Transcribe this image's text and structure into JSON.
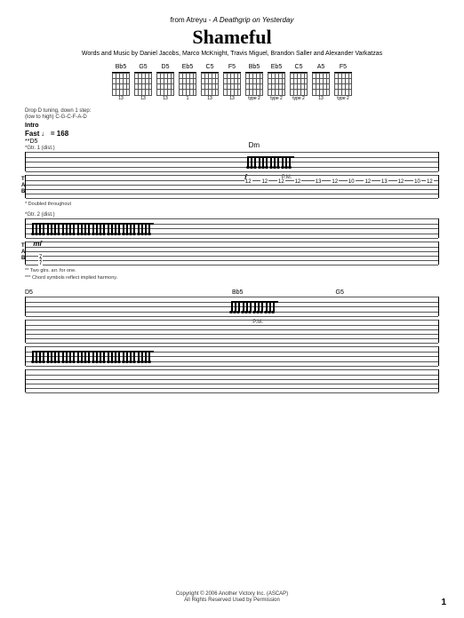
{
  "header": {
    "source_prefix": "from Atreyu - ",
    "album": "A Deathgrip on Yesterday",
    "title": "Shameful",
    "composers": "Words and Music by Daniel Jacobs, Marco McKnight, Travis Miguel, Brandon Saller and Alexander Varkatzas"
  },
  "chord_diagrams": [
    {
      "label": "Bb5",
      "sub": "13"
    },
    {
      "label": "G5",
      "sub": "13"
    },
    {
      "label": "D5",
      "sub": "13"
    },
    {
      "label": "Eb5",
      "sub": "1"
    },
    {
      "label": "C5",
      "sub": "13"
    },
    {
      "label": "F5",
      "sub": "13"
    },
    {
      "label": "Bb5",
      "sub": "type 2"
    },
    {
      "label": "Eb5",
      "sub": "type 2"
    },
    {
      "label": "C5",
      "sub": "type 2"
    },
    {
      "label": "A5",
      "sub": "13"
    },
    {
      "label": "F5",
      "sub": "type 2"
    }
  ],
  "tuning_notes": {
    "line1": "Drop D tuning, down 1 step:",
    "line2": "(low to high) C-G-C-F-A-D"
  },
  "sections": {
    "intro": {
      "label": "Intro",
      "tempo_label": "Fast ♩ = 168",
      "initial_chord": "**D5",
      "chord_mid": "Dm",
      "gtr1": {
        "label": "*Gtr. 1 (dist.)",
        "dynamic": "f",
        "pm": "P.M."
      },
      "gtr2": {
        "label": "*Gtr. 2 (dist.)",
        "dynamic": "mf",
        "doubled": "* Doubled throughout"
      },
      "tab_letters": "T\nA\nB",
      "tab_values_top": [
        "12",
        "12",
        "12",
        "12",
        "13",
        "12",
        "10",
        "12",
        "13",
        "12",
        "10",
        "12"
      ],
      "tab_values_bottom_row": "7",
      "footnote1": "** Two gtrs. arr. for one.",
      "footnote2": "*** Chord symbols reflect implied harmony."
    },
    "system2": {
      "chords": [
        "D5",
        "Bb5",
        "G5"
      ],
      "pm": "P.M."
    }
  },
  "footer": {
    "line1": "Copyright © 2006 Another Victory Inc. (ASCAP)",
    "line2": "All Rights Reserved   Used by Permission"
  },
  "page_number": "1"
}
